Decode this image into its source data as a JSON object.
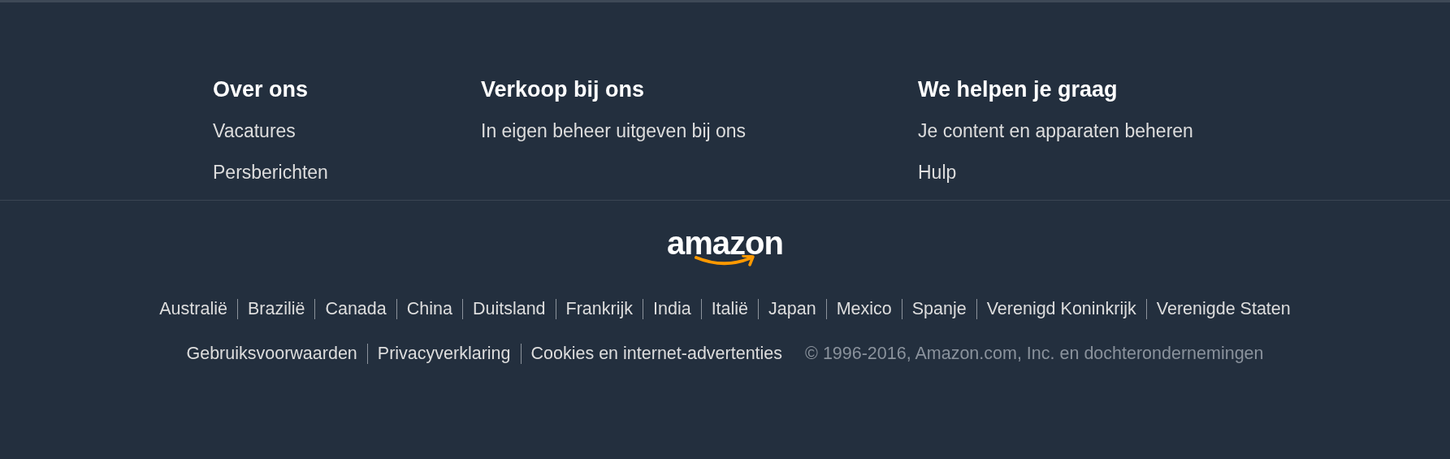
{
  "columns": [
    {
      "title": "Over ons",
      "links": [
        "Vacatures",
        "Persberichten"
      ]
    },
    {
      "title": "Verkoop bij ons",
      "links": [
        "In eigen beheer uitgeven bij ons"
      ]
    },
    {
      "title": "We helpen je graag",
      "links": [
        "Je content en apparaten beheren",
        "Hulp"
      ]
    }
  ],
  "logo": {
    "text": "amazon"
  },
  "countries": [
    "Australië",
    "Brazilië",
    "Canada",
    "China",
    "Duitsland",
    "Frankrijk",
    "India",
    "Italië",
    "Japan",
    "Mexico",
    "Spanje",
    "Verenigd Koninkrijk",
    "Verenigde Staten"
  ],
  "legal_links": [
    "Gebruiksvoorwaarden",
    "Privacyverklaring",
    "Cookies en internet-advertenties"
  ],
  "copyright": "© 1996-2016, Amazon.com, Inc. en dochterondernemingen"
}
